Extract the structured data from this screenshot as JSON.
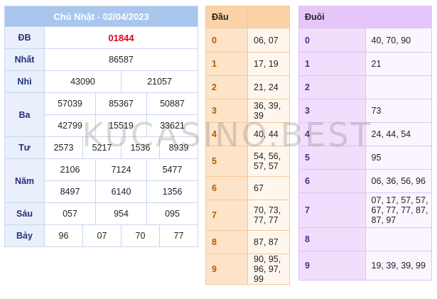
{
  "results": {
    "title": "Chủ Nhật - 02/04/2023",
    "rows": [
      {
        "label": "ĐB",
        "values": [
          "01844"
        ]
      },
      {
        "label": "Nhất",
        "values": [
          "86587"
        ]
      },
      {
        "label": "Nhì",
        "values": [
          "43090",
          "21057"
        ]
      },
      {
        "label": "Ba",
        "values": [
          "57039",
          "85367",
          "50887",
          "42799",
          "15519",
          "33621"
        ]
      },
      {
        "label": "Tư",
        "values": [
          "2573",
          "5217",
          "1536",
          "8939"
        ]
      },
      {
        "label": "Năm",
        "values": [
          "2106",
          "7124",
          "5477",
          "8497",
          "6140",
          "1356"
        ]
      },
      {
        "label": "Sáu",
        "values": [
          "057",
          "954",
          "095"
        ]
      },
      {
        "label": "Bảy",
        "values": [
          "96",
          "07",
          "70",
          "77"
        ]
      }
    ]
  },
  "dau": {
    "header": [
      "Đầu",
      ""
    ],
    "rows": [
      {
        "k": "0",
        "v": "06, 07"
      },
      {
        "k": "1",
        "v": "17, 19"
      },
      {
        "k": "2",
        "v": "21, 24"
      },
      {
        "k": "3",
        "v": "36, 39, 39"
      },
      {
        "k": "4",
        "v": "40, 44"
      },
      {
        "k": "5",
        "v": "54, 56, 57, 57"
      },
      {
        "k": "6",
        "v": "67"
      },
      {
        "k": "7",
        "v": "70, 73, 77, 77"
      },
      {
        "k": "8",
        "v": "87, 87"
      },
      {
        "k": "9",
        "v": "90, 95, 96, 97, 99"
      }
    ]
  },
  "duoi": {
    "header": [
      "Đuôi",
      ""
    ],
    "rows": [
      {
        "k": "0",
        "v": "40, 70, 90"
      },
      {
        "k": "1",
        "v": "21"
      },
      {
        "k": "2",
        "v": ""
      },
      {
        "k": "3",
        "v": "73"
      },
      {
        "k": "4",
        "v": "24, 44, 54"
      },
      {
        "k": "5",
        "v": "95"
      },
      {
        "k": "6",
        "v": "06, 36, 56, 96"
      },
      {
        "k": "7",
        "v": "07, 17, 57, 57, 67, 77, 77, 87, 87, 97"
      },
      {
        "k": "8",
        "v": ""
      },
      {
        "k": "9",
        "v": "19, 39, 39, 99"
      }
    ]
  },
  "watermark": "KUCASINO.BEST"
}
